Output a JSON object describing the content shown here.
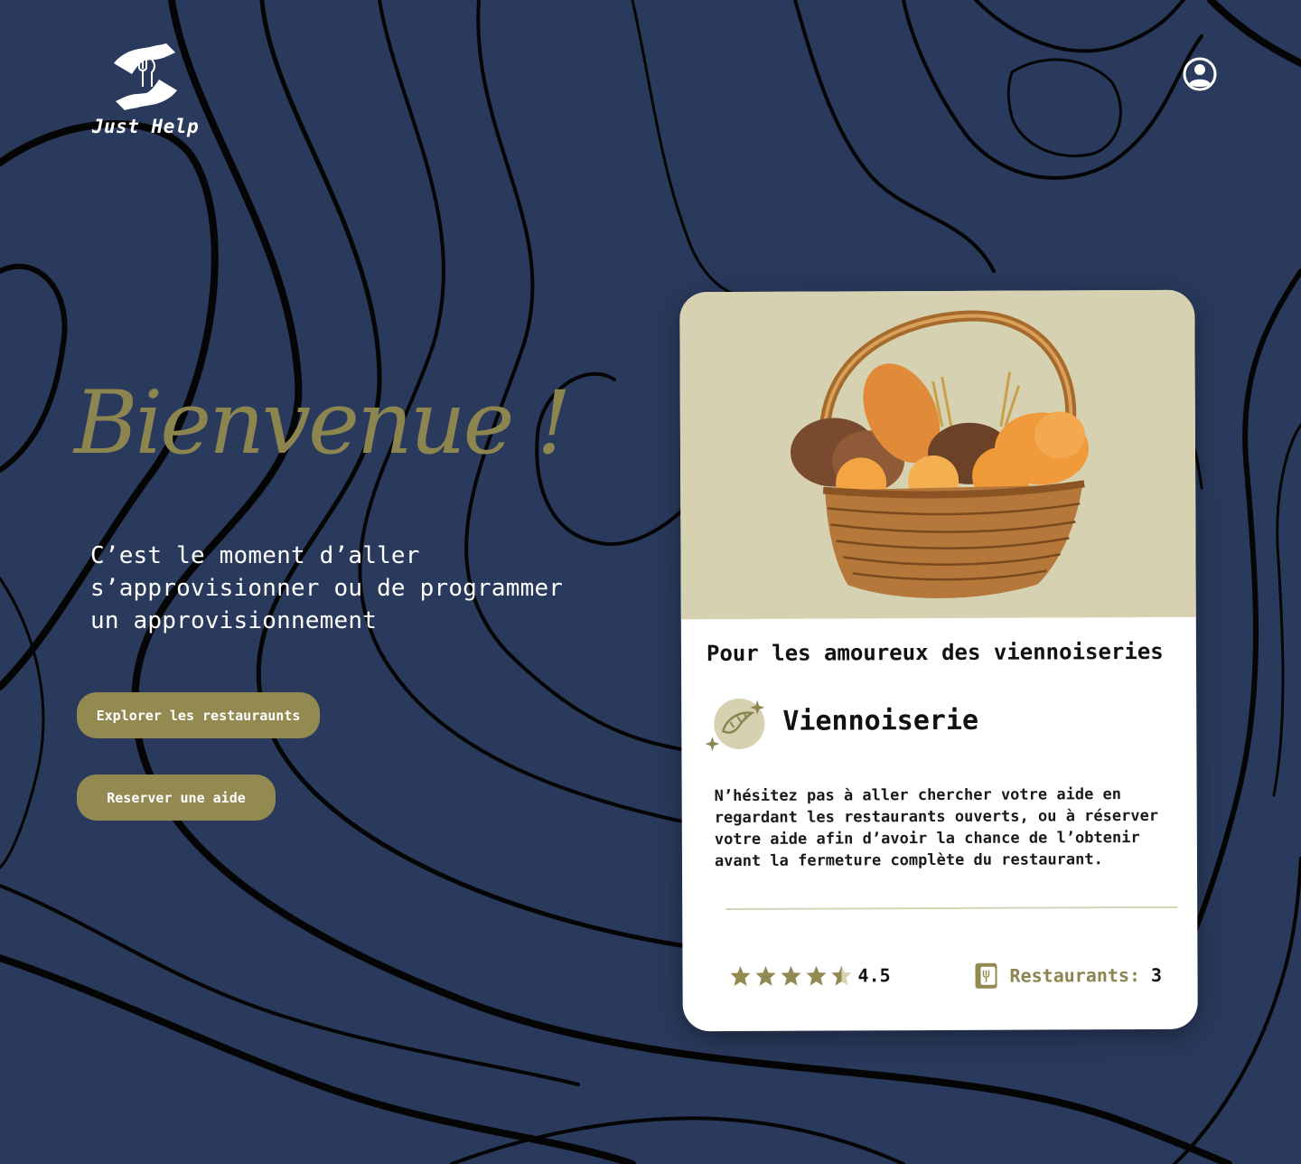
{
  "brand": {
    "name": "Just Help"
  },
  "header": {
    "account_icon": "user-circle-icon"
  },
  "hero": {
    "title": "Bienvenue !",
    "subtitle": "C’est le moment d’aller s’approvisionner ou de programmer un approvisionnement",
    "explore_button": "Explorer les restaurаunts",
    "reserve_button": "Reserver une aide"
  },
  "card": {
    "image": "bread-basket",
    "title": "Pour les amoureux des viennoiseries",
    "category_icon": "croissant-icon",
    "category": "Viennoiserie",
    "description": "N’hésitez pas à aller chercher votre aide en regardant les restaurants ouverts, ou à réserver votre aide afin d’avoir la chance de l’obtenir avant la fermeture complète du restaurant.",
    "rating": {
      "value": "4.5",
      "stars": 4.5,
      "max": 5
    },
    "restaurants_label": "Restaurants:",
    "restaurants_count": "3"
  },
  "colors": {
    "background": "#2a3a5c",
    "accent": "#938a52",
    "card_image_bg": "#d5d1b1",
    "title_gold": "#8c8550"
  }
}
